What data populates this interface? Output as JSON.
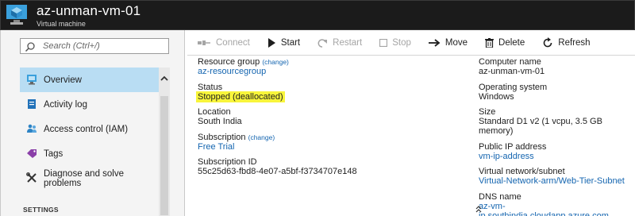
{
  "header": {
    "title": "az-unman-vm-01",
    "subtitle": "Virtual machine",
    "background": "#1b1b1b",
    "icon": "vm-cube-icon"
  },
  "sidebar": {
    "search_placeholder": "Search (Ctrl+/)",
    "items": [
      {
        "label": "Overview",
        "icon": "monitor-icon",
        "active": true
      },
      {
        "label": "Activity log",
        "icon": "activity-log-icon"
      },
      {
        "label": "Access control (IAM)",
        "icon": "users-icon"
      },
      {
        "label": "Tags",
        "icon": "tag-icon"
      },
      {
        "label": "Diagnose and solve problems",
        "icon": "wrench-icon"
      }
    ],
    "section_label": "SETTINGS"
  },
  "toolbar": {
    "connect": "Connect",
    "start": "Start",
    "restart": "Restart",
    "stop": "Stop",
    "move": "Move",
    "delete": "Delete",
    "refresh": "Refresh"
  },
  "essentials": {
    "left": {
      "resource_group_label": "Resource group",
      "resource_group_change": "(change)",
      "resource_group_value": "az-resourcegroup",
      "status_label": "Status",
      "status_value": "Stopped (deallocated)",
      "location_label": "Location",
      "location_value": "South India",
      "subscription_label": "Subscription",
      "subscription_change": "(change)",
      "subscription_value": "Free Trial",
      "subscription_id_label": "Subscription ID",
      "subscription_id_value": "55c25d63-fbd8-4e07-a5bf-f3734707e148"
    },
    "right": {
      "computer_name_label": "Computer name",
      "computer_name_value": "az-unman-vm-01",
      "os_label": "Operating system",
      "os_value": "Windows",
      "size_label": "Size",
      "size_value": "Standard D1 v2 (1 vcpu, 3.5 GB memory)",
      "public_ip_label": "Public IP address",
      "public_ip_value": "vm-ip-address",
      "vnet_label": "Virtual network/subnet",
      "vnet_value": "Virtual-Network-arm/Web-Tier-Subnet",
      "dns_label": "DNS name",
      "dns_value": "az-vm-ip.southindia.cloudapp.azure.com"
    }
  },
  "colors": {
    "accent_link": "#1465b0",
    "active_nav": "#b9ddf3",
    "status_highlight": "#f8f53b"
  }
}
